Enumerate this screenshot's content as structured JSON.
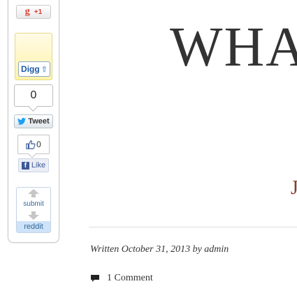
{
  "share_bar": {
    "google_plus": {
      "glyph": "g",
      "count": "+1"
    },
    "digg": {
      "label": "Digg",
      "arrow": "⇧"
    },
    "twitter": {
      "count": "0",
      "label": "Tweet"
    },
    "facebook": {
      "count": "0",
      "label": "Like",
      "glyph": "f"
    },
    "reddit": {
      "submit_label": "submit",
      "brand": "reddit"
    }
  },
  "post": {
    "title": "WHA",
    "subtitle": "J",
    "byline": "Written October 31, 2013 by admin",
    "comments_label": "1 Comment"
  },
  "colors": {
    "google_red": "#d73d32",
    "digg_blue": "#1e5aa8",
    "twitter_blue": "#1da1f2",
    "facebook_blue": "#3b5998",
    "reddit_blue": "#336699",
    "subtitle_red": "#8b3a2a"
  }
}
